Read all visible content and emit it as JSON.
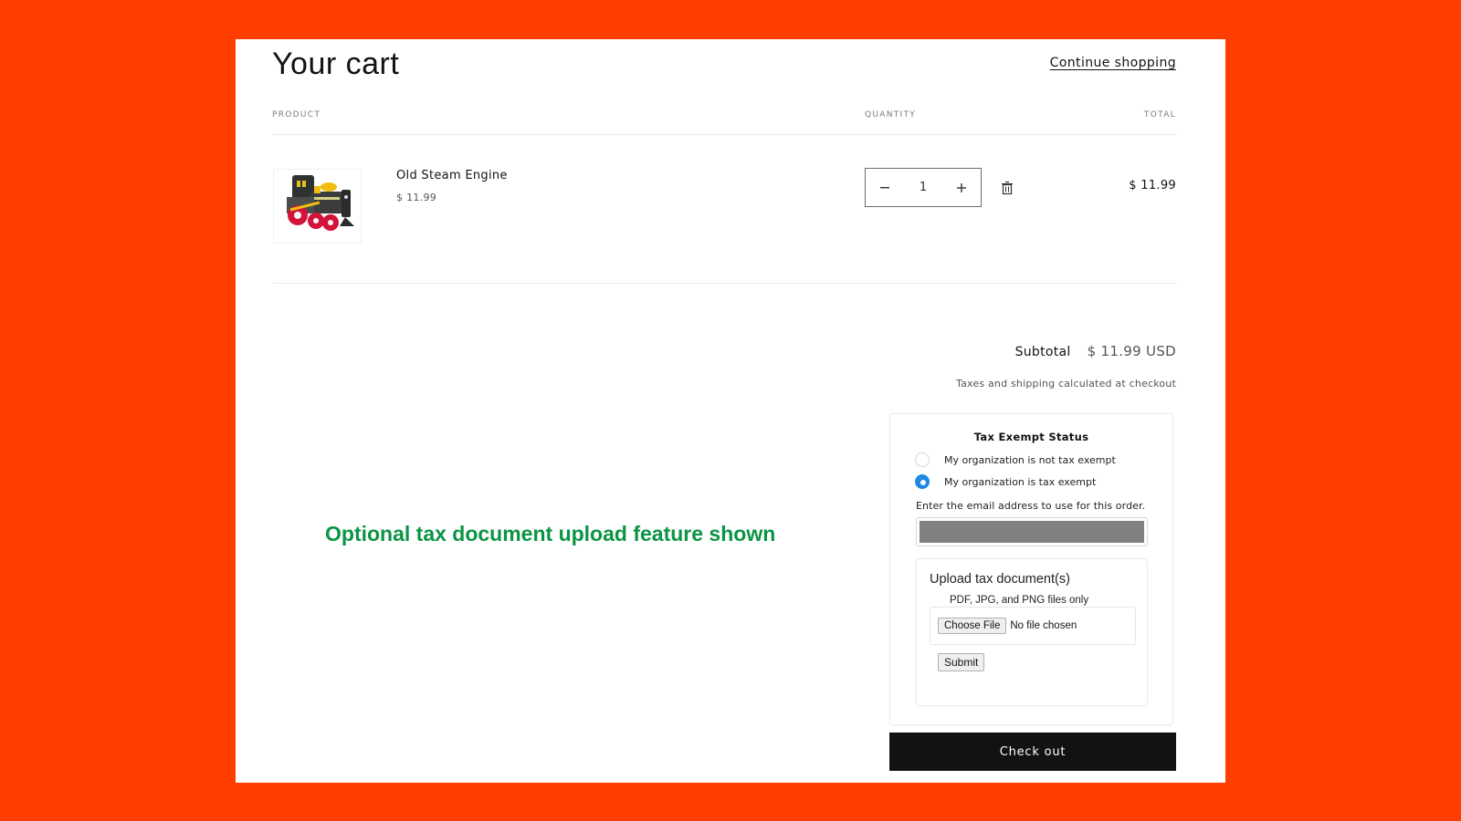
{
  "header": {
    "title": "Your cart",
    "continue_shopping": "Continue shopping"
  },
  "table": {
    "columns": [
      "PRODUCT",
      "QUANTITY",
      "TOTAL"
    ],
    "items": [
      {
        "name": "Old Steam Engine",
        "unit_price": "$ 11.99",
        "quantity": "1",
        "line_total": "$ 11.99",
        "image": "toy-steam-engine"
      }
    ]
  },
  "stepper": {
    "decrease_icon": "minus-icon",
    "increase_icon": "plus-icon",
    "remove_icon": "trash-icon"
  },
  "summary": {
    "subtotal_label": "Subtotal",
    "subtotal_value": "$ 11.99 USD",
    "tax_note": "Taxes and shipping calculated at checkout"
  },
  "tax_exempt": {
    "title": "Tax Exempt Status",
    "options": [
      {
        "label": "My organization is not tax exempt",
        "checked": false
      },
      {
        "label": "My organization is tax exempt",
        "checked": true
      }
    ],
    "email_label": "Enter the email address to use for this order.",
    "email_value": "",
    "upload": {
      "title": "Upload tax document(s)",
      "hint": "PDF, JPG, and PNG files only",
      "choose_label": "Choose File",
      "file_status": "No file chosen",
      "submit_label": "Submit"
    }
  },
  "checkout_label": "Check out",
  "annotation": "Optional tax document upload feature shown",
  "colors": {
    "background": "#ff3d00",
    "accent_radio": "#1e88e5",
    "checkout_bg": "#121212",
    "annotation": "#0b9444"
  }
}
